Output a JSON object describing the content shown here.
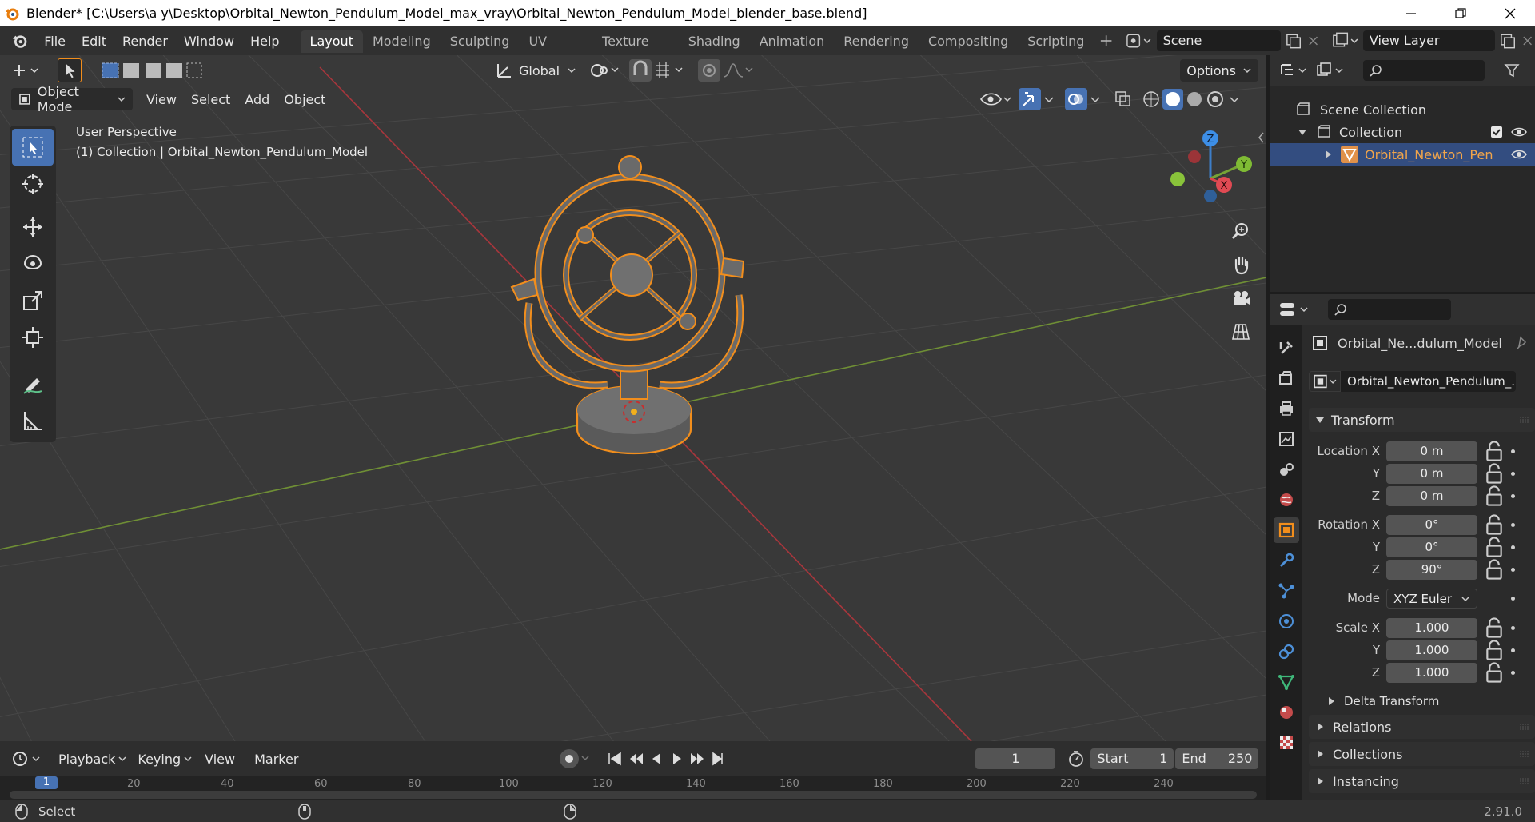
{
  "window": {
    "title": "Blender* [C:\\Users\\a y\\Desktop\\Orbital_Newton_Pendulum_Model_max_vray\\Orbital_Newton_Pendulum_Model_blender_base.blend]"
  },
  "menu": [
    "File",
    "Edit",
    "Render",
    "Window",
    "Help"
  ],
  "workspaces": [
    "Layout",
    "Modeling",
    "Sculpting",
    "UV Editing",
    "Texture Paint",
    "Shading",
    "Animation",
    "Rendering",
    "Compositing",
    "Scripting"
  ],
  "active_workspace": "Layout",
  "scene": "Scene",
  "view_layer": "View Layer",
  "tool_header": {
    "orientation": "Global",
    "options": "Options"
  },
  "viewport_header": {
    "mode": "Object Mode",
    "menus": [
      "View",
      "Select",
      "Add",
      "Object"
    ]
  },
  "viewport": {
    "perspective": "User Perspective",
    "collection_info": "(1) Collection | Orbital_Newton_Pendulum_Model",
    "gizmo_labels": {
      "z": "Z",
      "y": "Y",
      "x": "X"
    }
  },
  "outliner": {
    "scene_collection": "Scene Collection",
    "collection": "Collection",
    "object": "Orbital_Newton_Pen"
  },
  "properties": {
    "object_name": "Orbital_Ne...dulum_Model",
    "data_name": "Orbital_Newton_Pendulum_...",
    "transform_title": "Transform",
    "location": {
      "label": "Location X",
      "x": "0 m",
      "y": "0 m",
      "z": "0 m"
    },
    "rotation": {
      "label": "Rotation X",
      "x": "0°",
      "y": "0°",
      "z": "90°"
    },
    "mode_label": "Mode",
    "mode": "XYZ Euler",
    "scale": {
      "label": "Scale X",
      "x": "1.000",
      "y": "1.000",
      "z": "1.000"
    },
    "axis_y": "Y",
    "axis_z": "Z",
    "panels": [
      "Delta Transform",
      "Relations",
      "Collections",
      "Instancing"
    ]
  },
  "timeline": {
    "menus": [
      "Playback",
      "Keying",
      "View",
      "Marker"
    ],
    "current_frame": "1",
    "start_label": "Start",
    "start": "1",
    "end_label": "End",
    "end": "250",
    "ruler": [
      "1",
      "20",
      "40",
      "60",
      "80",
      "100",
      "120",
      "140",
      "160",
      "180",
      "200",
      "220",
      "240"
    ]
  },
  "status": {
    "left": "Select",
    "version": "2.91.0"
  },
  "colors": {
    "selection": "#f28e1c",
    "x_axis": "#c0393f",
    "y_axis": "#7ea33b",
    "active_blue": "#4772b3"
  }
}
